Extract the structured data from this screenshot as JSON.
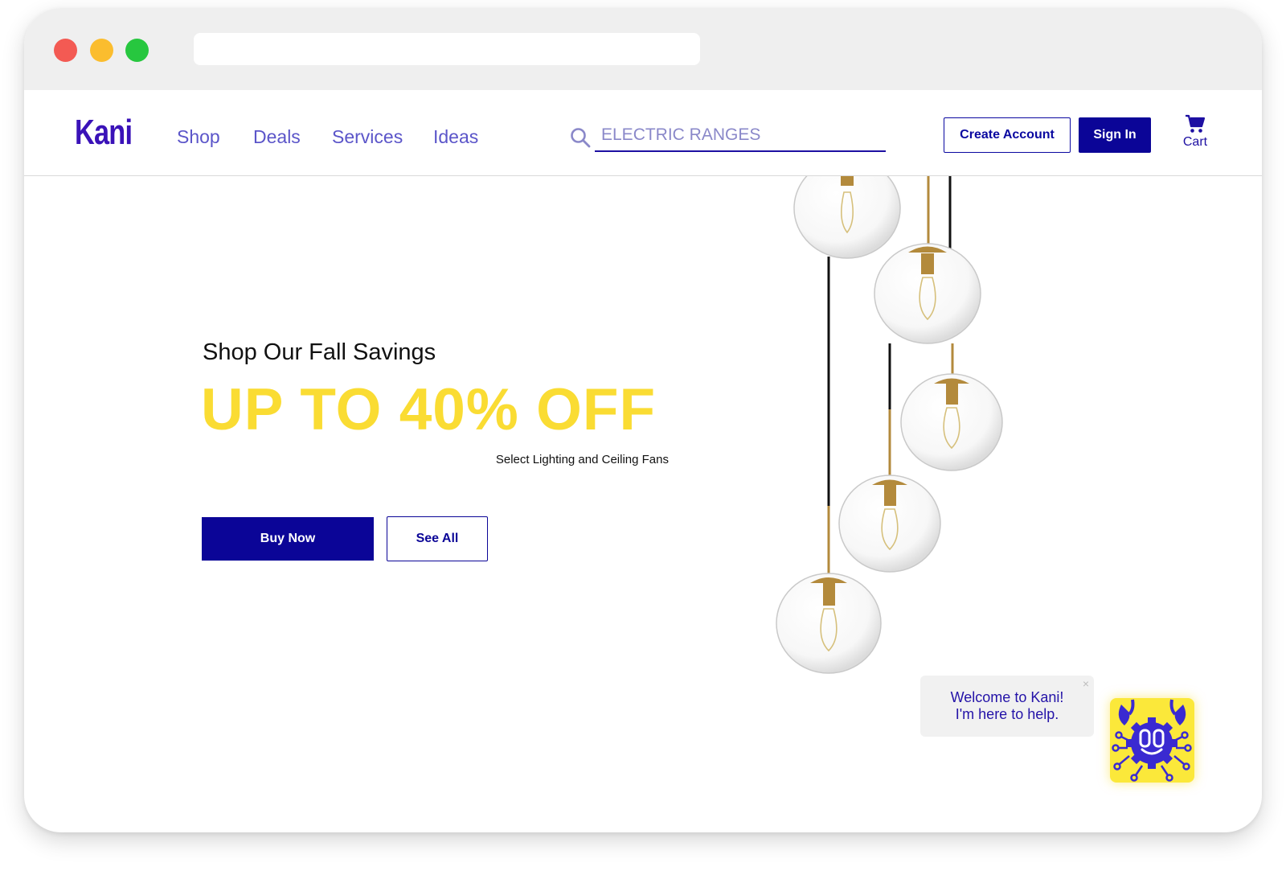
{
  "nav": {
    "logo": "Kani",
    "links": [
      "Shop",
      "Deals",
      "Services",
      "Ideas"
    ],
    "search_value": "ELECTRIC RANGES",
    "create_account": "Create Account",
    "sign_in": "Sign In",
    "cart": "Cart"
  },
  "hero": {
    "subtitle": "Shop Our Fall Savings",
    "title": "UP TO 40% OFF",
    "note": "Select Lighting and Ceiling Fans",
    "buy_now": "Buy Now",
    "see_all": "See All"
  },
  "chat": {
    "line1": "Welcome to Kani!",
    "line2": "I'm here to help.",
    "close": "×"
  },
  "colors": {
    "brand": "#3a12b8",
    "primary": "#0b0597",
    "accent_yellow": "#fadc33",
    "nav_link": "#5b55c9"
  },
  "icons": [
    "search-icon",
    "cart-icon",
    "close-icon",
    "bot-icon"
  ]
}
